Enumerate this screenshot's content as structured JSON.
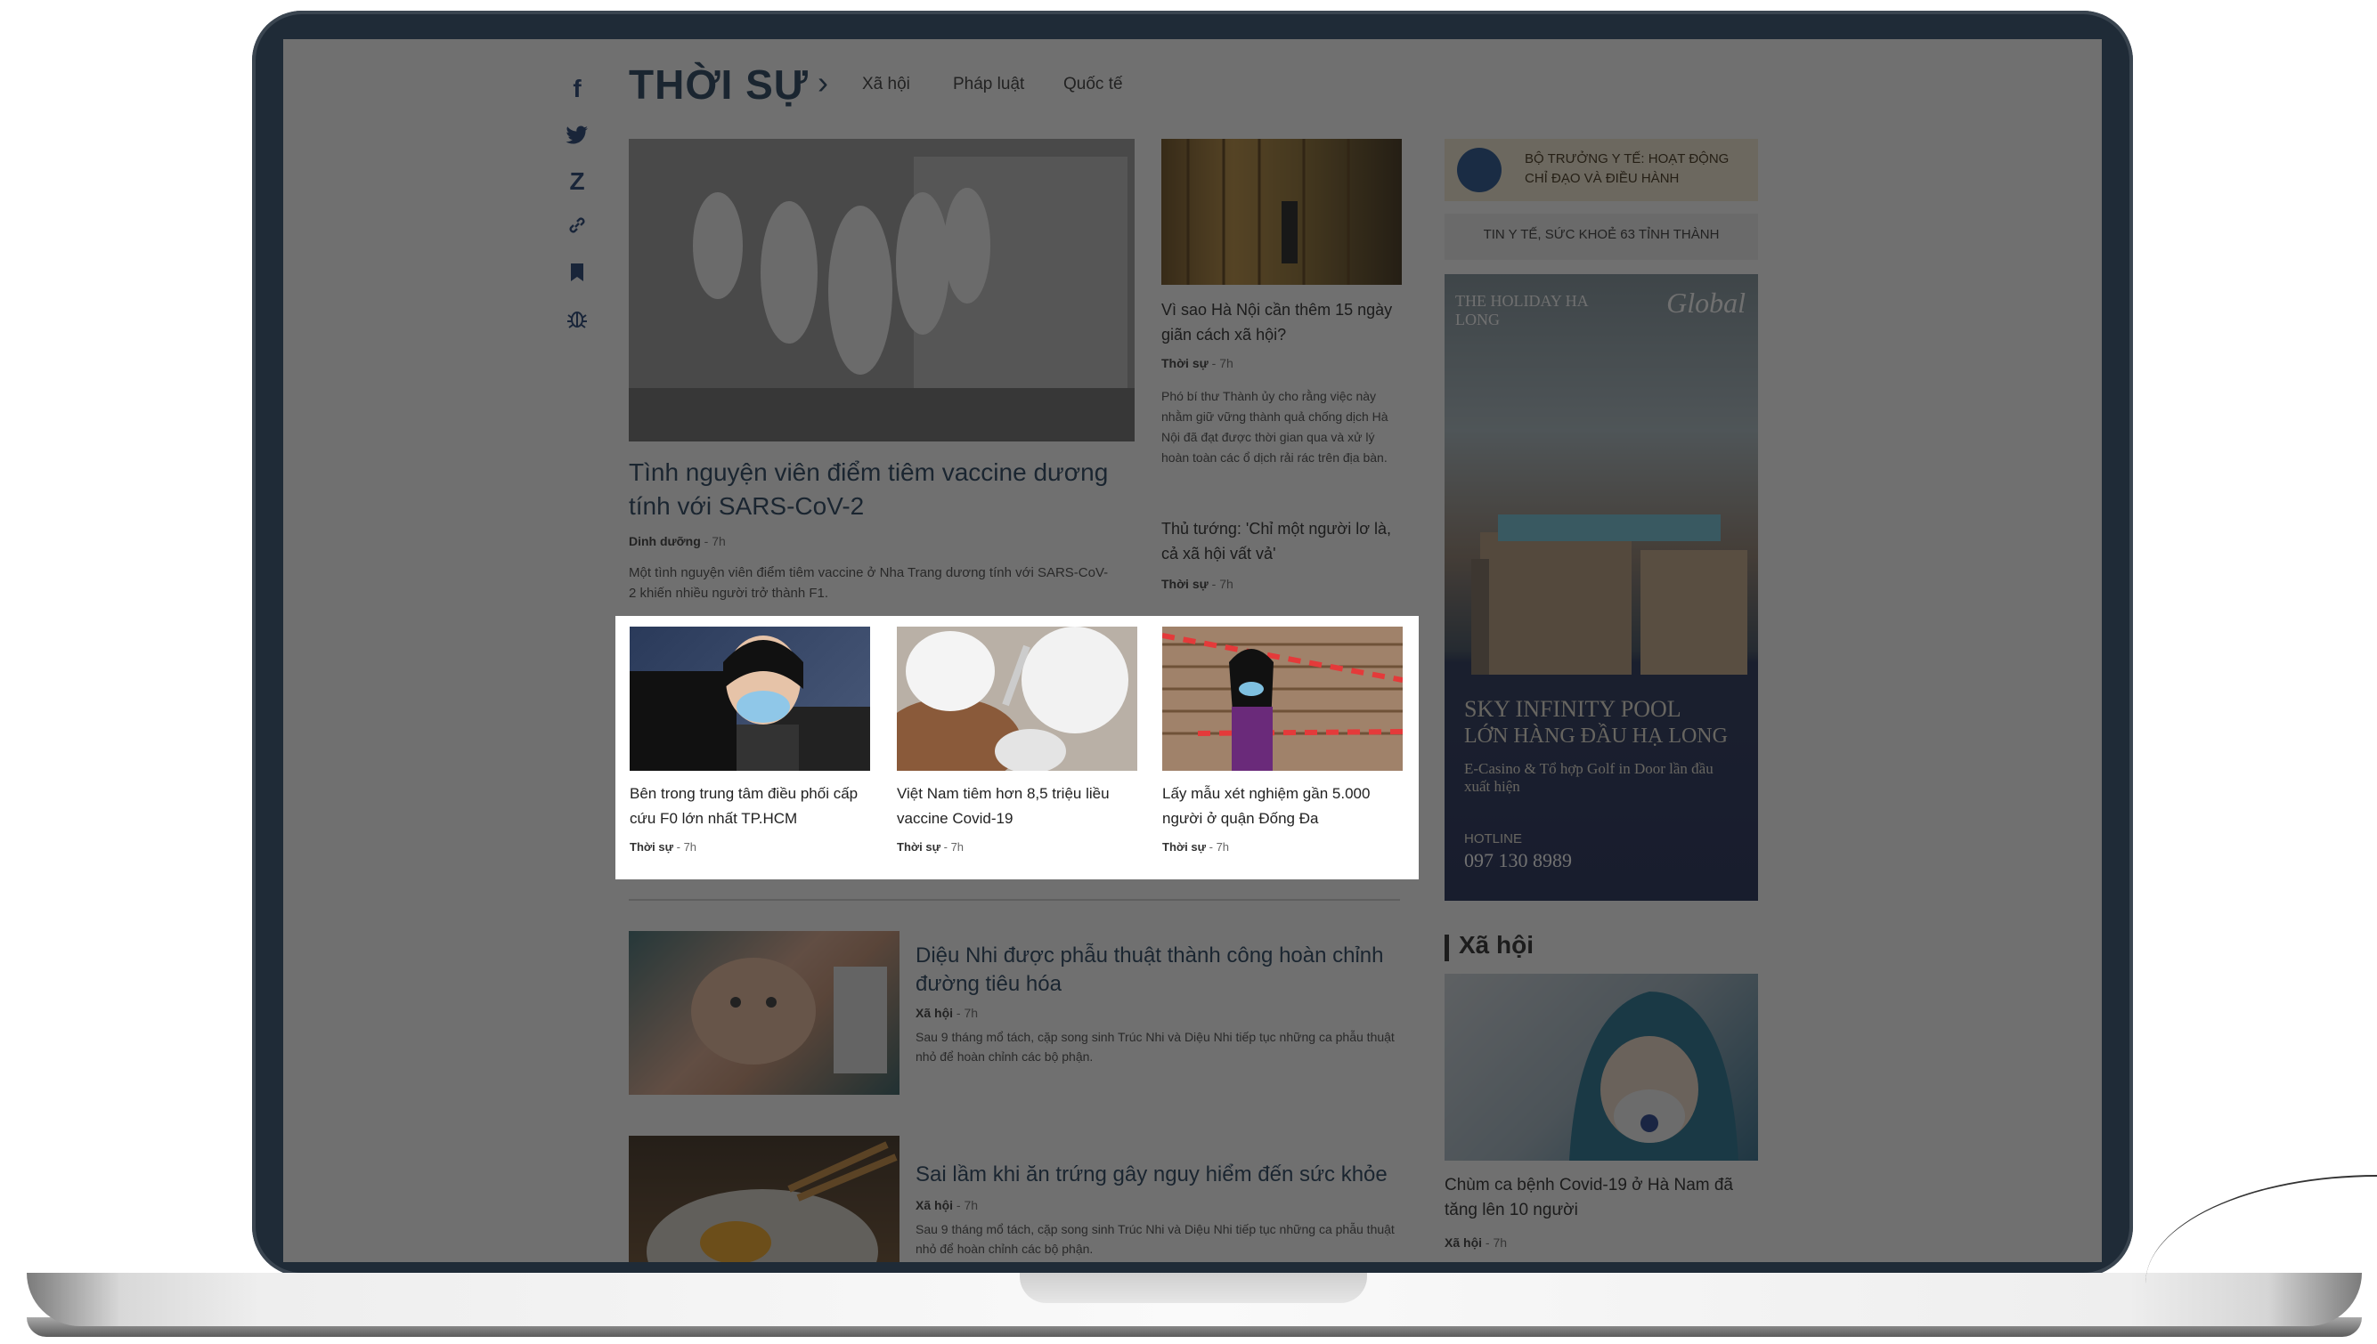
{
  "share": {
    "facebook": "f",
    "twitter": "twitter-icon",
    "zalo": "Z",
    "link": "link-icon",
    "bookmark": "bookmark-icon",
    "report": "bug-icon"
  },
  "nav": {
    "section": "THỜI SỰ",
    "arrow": "›",
    "subs": [
      "Xã hội",
      "Pháp luật",
      "Quốc tế"
    ]
  },
  "main_story": {
    "title": "Tình nguyện viên điểm tiêm vaccine dương tính với SARS-CoV-2",
    "category": "Dinh dưỡng",
    "time": "7h",
    "sapo": "Một tình nguyện viên điểm tiêm vaccine ở Nha Trang dương tính với SARS-CoV-2 khiến nhiều người trở thành F1."
  },
  "side_stories": [
    {
      "title": "Vì sao Hà Nội cần thêm 15 ngày giãn cách xã hội?",
      "category": "Thời sự",
      "time": "7h",
      "sapo": "Phó bí thư Thành ủy cho rằng việc này nhằm giữ vững thành quả chống dịch Hà Nội đã đạt được thời gian qua và xử lý hoàn toàn các ổ dịch rải rác trên địa bàn."
    },
    {
      "title": "Thủ tướng: 'Chỉ một người lơ là, cả xã hội vất vả'",
      "category": "Thời sự",
      "time": "7h"
    }
  ],
  "row_stories": [
    {
      "title": "Bên trong trung tâm điều phối cấp cứu F0 lớn nhất TP.HCM",
      "category": "Thời sự",
      "time": "7h"
    },
    {
      "title": "Việt Nam tiêm hơn 8,5 triệu liều vaccine Covid-19",
      "category": "Thời sự",
      "time": "7h"
    },
    {
      "title": "Lấy mẫu xét nghiệm gần 5.000 người ở quận Đống Đa",
      "category": "Thời sự",
      "time": "7h"
    }
  ],
  "list_stories": [
    {
      "title": "Diệu Nhi được phẫu thuật thành công hoàn chỉnh đường tiêu hóa",
      "category": "Xã hội",
      "time": "7h",
      "sapo": "Sau 9 tháng mổ tách, cặp song sinh Trúc Nhi và Diệu Nhi tiếp tục những ca phẫu thuật nhỏ để hoàn chỉnh các bộ phận."
    },
    {
      "title": "Sai lầm khi ăn trứng gây nguy hiểm đến sức khỏe",
      "category": "Xã hội",
      "time": "7h",
      "sapo": "Sau 9 tháng mổ tách, cặp song sinh Trúc Nhi và Diệu Nhi tiếp tục những ca phẫu thuật nhỏ để hoàn chỉnh các bộ phận."
    }
  ],
  "sidebar": {
    "minister_banner": "BỘ TRƯỞNG Y TẾ: HOẠT ĐỘNG CHỈ ĐẠO VÀ ĐIỀU HÀNH",
    "provinces_link": "TIN Y TẾ, SỨC KHOẺ 63 TỈNH THÀNH",
    "ad": {
      "brand_left": "THE HOLIDAY HA LONG",
      "brand_right": "Global",
      "headline_1": "SKY INFINITY POOL",
      "headline_2": "LỚN HÀNG ĐẦU HẠ LONG",
      "sub": "E-Casino & Tổ hợp Golf in Door lần đầu xuất hiện",
      "hotline_label": "HOTLINE",
      "hotline": "097 130 8989"
    },
    "section": "Xã hội",
    "story": {
      "title": "Chùm ca bệnh Covid-19 ở Hà Nam đã tăng lên 10 người",
      "category": "Xã hội",
      "time": "7h"
    }
  },
  "colors": {
    "brand": "#1e3a57",
    "bezel": "#1f2b37",
    "overlay": "rgba(25,25,25,0.62)"
  }
}
